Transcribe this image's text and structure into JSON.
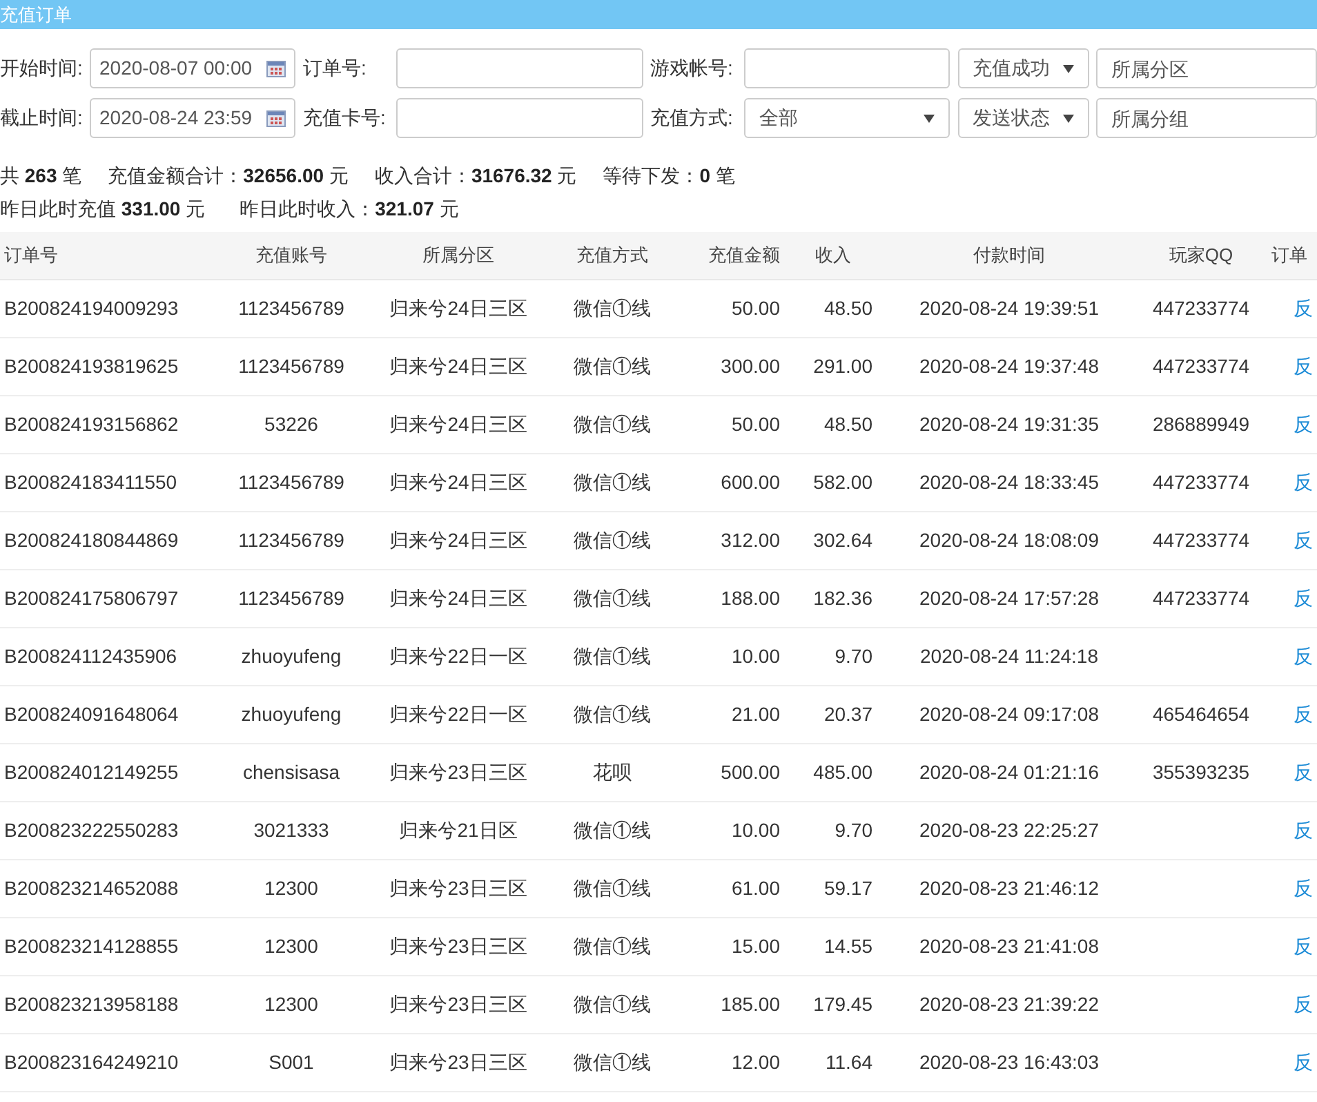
{
  "title": "充值订单",
  "filters": [
    [
      {
        "kind": "date",
        "label": "开始时间:",
        "value": "2020-08-07 00:00"
      },
      {
        "kind": "text",
        "label": "订单号:"
      },
      {
        "kind": "text",
        "label": "游戏帐号:"
      },
      {
        "kind": "select",
        "value": "充值成功"
      },
      {
        "kind": "text",
        "placeholder": "所属分区"
      }
    ],
    [
      {
        "kind": "date",
        "label": "截止时间:",
        "value": "2020-08-24 23:59"
      },
      {
        "kind": "text",
        "label": "充值卡号:"
      },
      {
        "kind": "select",
        "label": "充值方式:",
        "value": "全部"
      },
      {
        "kind": "select",
        "value": "发送状态"
      },
      {
        "kind": "text",
        "placeholder": "所属分组"
      }
    ]
  ],
  "summary": [
    [
      "共 **263** 笔",
      "充值金额合计：**32656.00** 元",
      "收入合计：**31676.32** 元",
      "等待下发：**0** 笔"
    ],
    [
      "昨日此时充值 **331.00** 元",
      "昨日此时收入：**321.07** 元"
    ]
  ],
  "table": {
    "columns": [
      "订单号",
      "充值账号",
      "所属分区",
      "充值方式",
      "充值金额",
      "收入",
      "付款时间",
      "玩家QQ",
      "订单"
    ],
    "rows": [
      [
        "B200824194009293",
        "1123456789",
        "归来兮24日三区",
        "微信①线",
        "50.00",
        "48.50",
        "2020-08-24 19:39:51",
        "447233774",
        "反"
      ],
      [
        "B200824193819625",
        "1123456789",
        "归来兮24日三区",
        "微信①线",
        "300.00",
        "291.00",
        "2020-08-24 19:37:48",
        "447233774",
        "反"
      ],
      [
        "B200824193156862",
        "53226",
        "归来兮24日三区",
        "微信①线",
        "50.00",
        "48.50",
        "2020-08-24 19:31:35",
        "286889949",
        "反"
      ],
      [
        "B200824183411550",
        "1123456789",
        "归来兮24日三区",
        "微信①线",
        "600.00",
        "582.00",
        "2020-08-24 18:33:45",
        "447233774",
        "反"
      ],
      [
        "B200824180844869",
        "1123456789",
        "归来兮24日三区",
        "微信①线",
        "312.00",
        "302.64",
        "2020-08-24 18:08:09",
        "447233774",
        "反"
      ],
      [
        "B200824175806797",
        "1123456789",
        "归来兮24日三区",
        "微信①线",
        "188.00",
        "182.36",
        "2020-08-24 17:57:28",
        "447233774",
        "反"
      ],
      [
        "B200824112435906",
        "zhuoyufeng",
        "归来兮22日一区",
        "微信①线",
        "10.00",
        "9.70",
        "2020-08-24 11:24:18",
        "",
        "反"
      ],
      [
        "B200824091648064",
        "zhuoyufeng",
        "归来兮22日一区",
        "微信①线",
        "21.00",
        "20.37",
        "2020-08-24 09:17:08",
        "465464654",
        "反"
      ],
      [
        "B200824012149255",
        "chensisasa",
        "归来兮23日三区",
        "花呗",
        "500.00",
        "485.00",
        "2020-08-24 01:21:16",
        "355393235",
        "反"
      ],
      [
        "B200823222550283",
        "3021333",
        "归来兮21日区",
        "微信①线",
        "10.00",
        "9.70",
        "2020-08-23 22:25:27",
        "",
        "反"
      ],
      [
        "B200823214652088",
        "12300",
        "归来兮23日三区",
        "微信①线",
        "61.00",
        "59.17",
        "2020-08-23 21:46:12",
        "",
        "反"
      ],
      [
        "B200823214128855",
        "12300",
        "归来兮23日三区",
        "微信①线",
        "15.00",
        "14.55",
        "2020-08-23 21:41:08",
        "",
        "反"
      ],
      [
        "B200823213958188",
        "12300",
        "归来兮23日三区",
        "微信①线",
        "185.00",
        "179.45",
        "2020-08-23 21:39:22",
        "",
        "反"
      ],
      [
        "B200823164249210",
        "S001",
        "归来兮23日三区",
        "微信①线",
        "12.00",
        "11.64",
        "2020-08-23 16:43:03",
        "",
        "反"
      ]
    ]
  }
}
